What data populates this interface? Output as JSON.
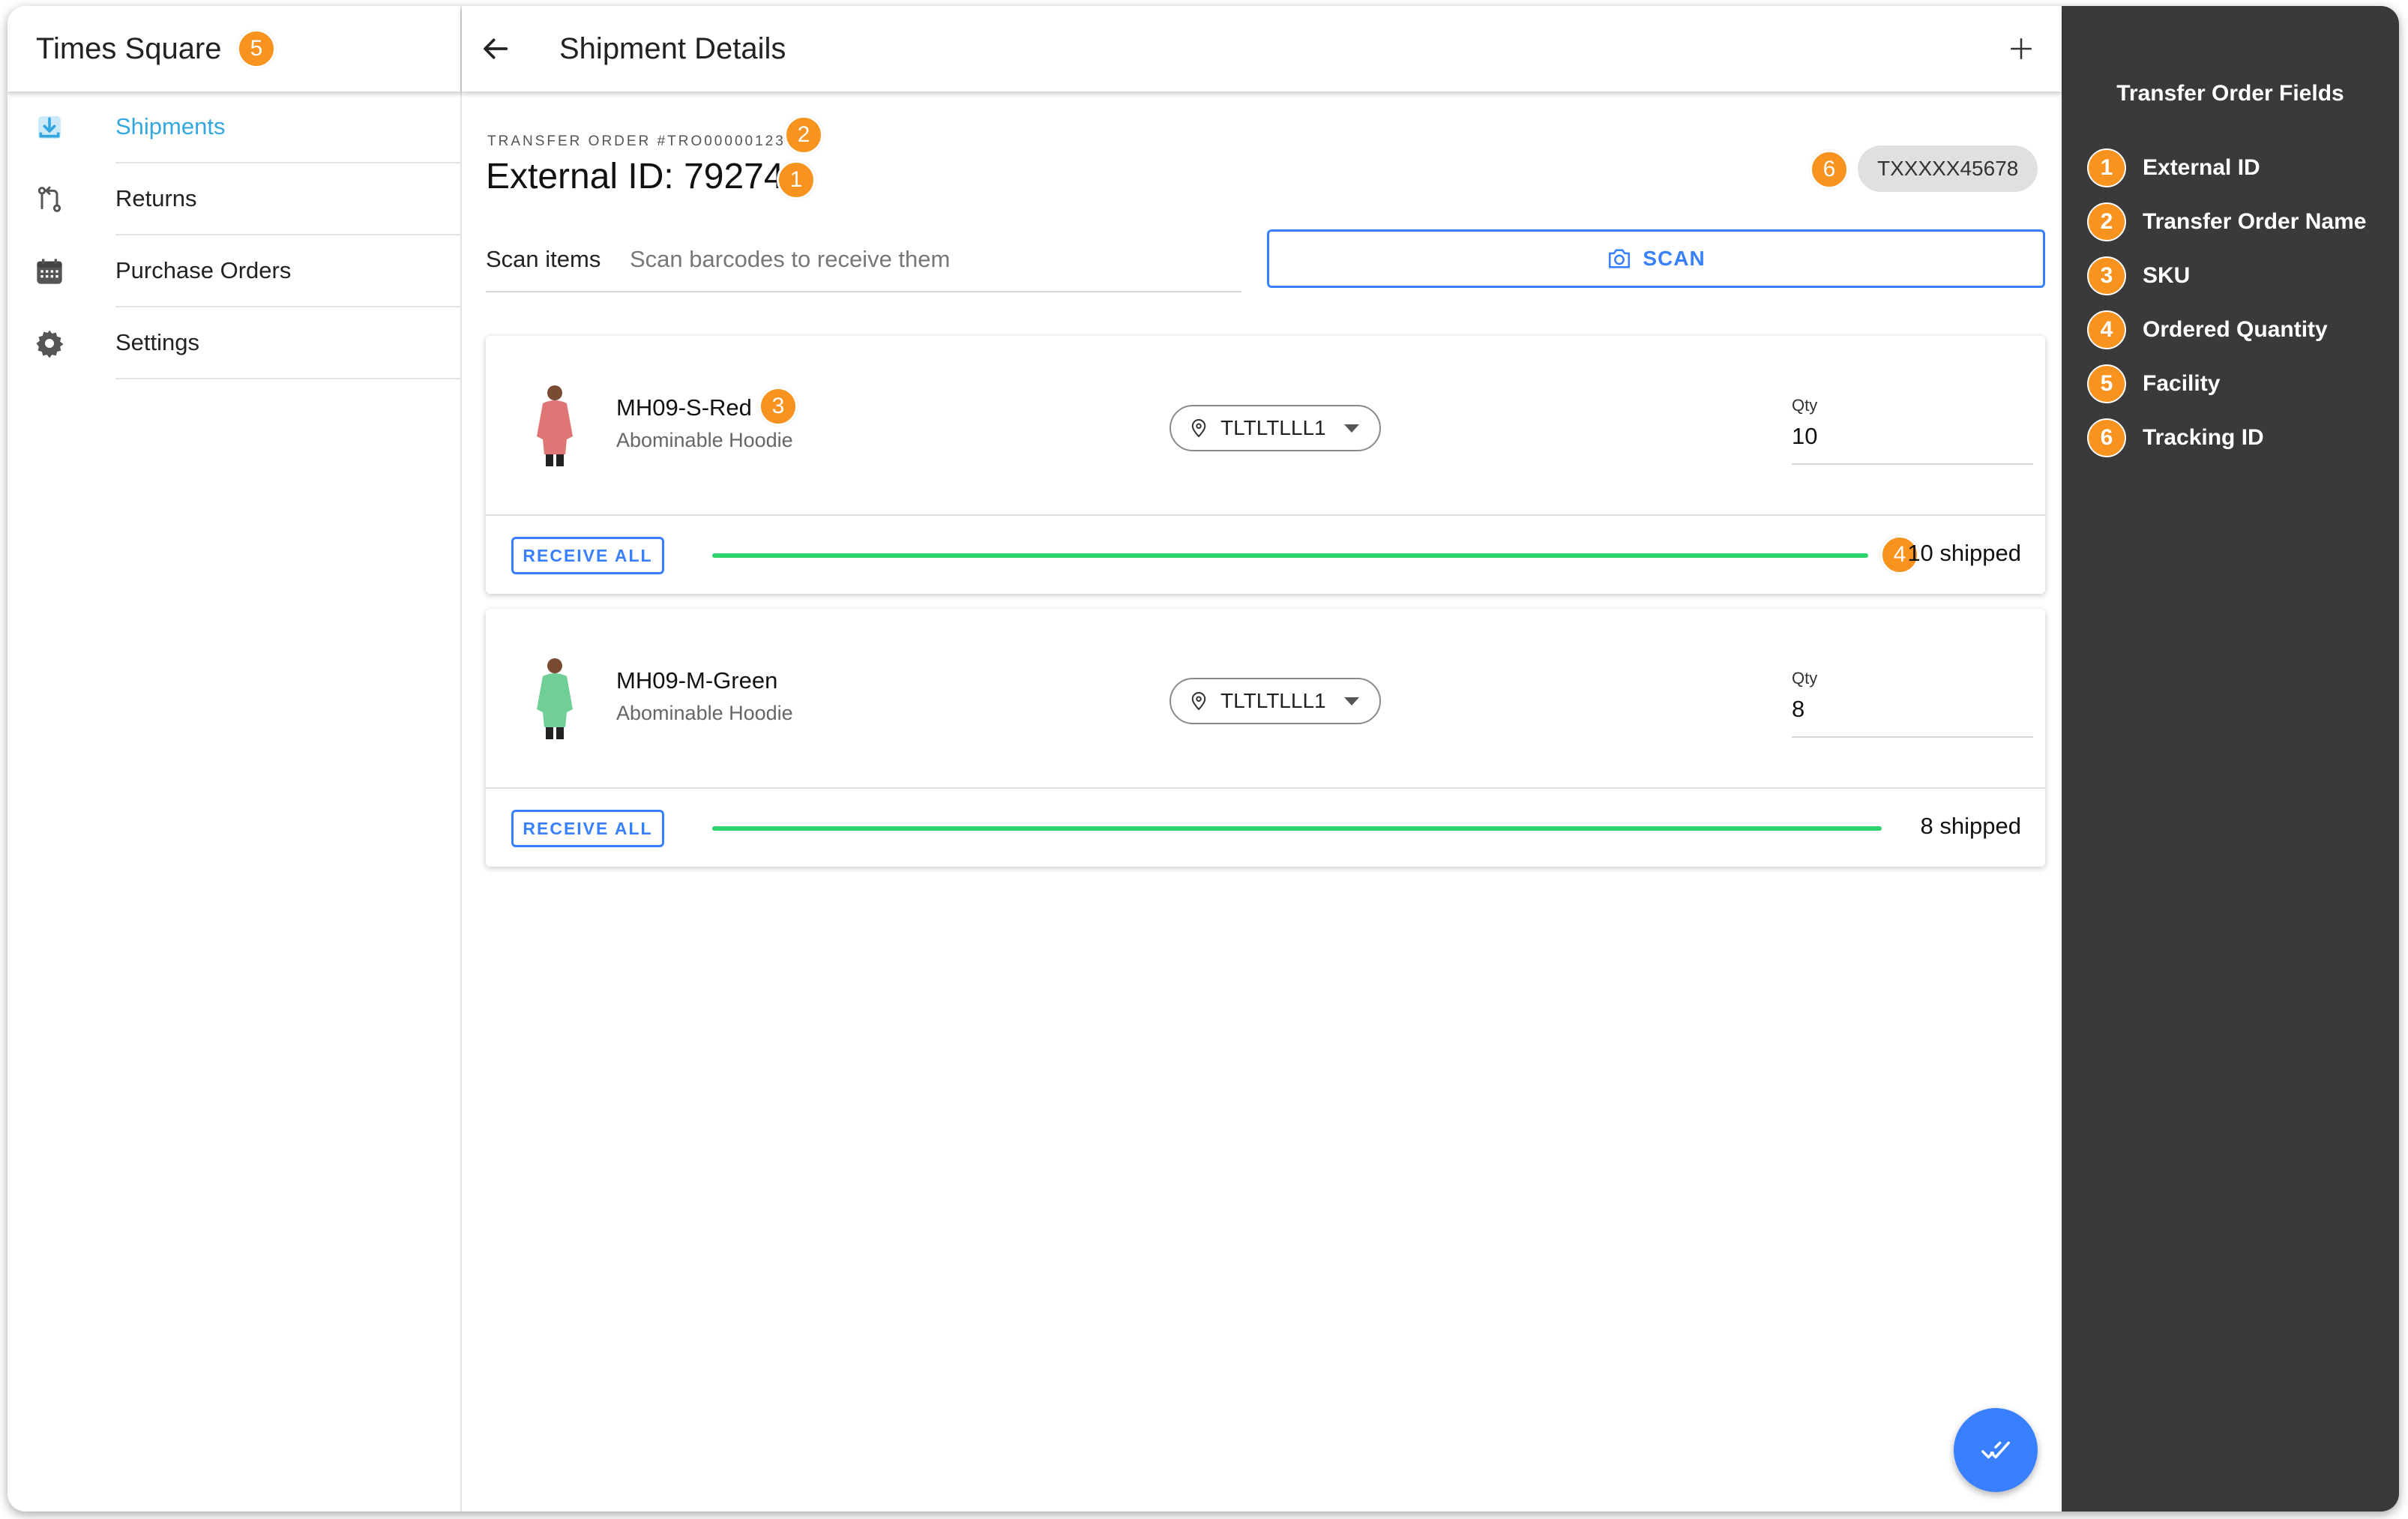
{
  "sidebar": {
    "facility": "Times Square",
    "items": [
      {
        "label": "Shipments",
        "icon": "download-icon",
        "active": true
      },
      {
        "label": "Returns",
        "icon": "git-compare-icon",
        "active": false
      },
      {
        "label": "Purchase Orders",
        "icon": "calendar-icon",
        "active": false
      },
      {
        "label": "Settings",
        "icon": "settings-icon",
        "active": false
      }
    ]
  },
  "toolbar": {
    "title": "Shipment Details",
    "back_icon": "arrow-back-icon",
    "add_icon": "add-icon"
  },
  "shipment": {
    "transfer_order_label": "TRANSFER ORDER #TRO00000123",
    "external_id": "External ID: 79274",
    "tracking_id": "TXXXXX45678"
  },
  "scan": {
    "label": "Scan items",
    "placeholder": "Scan barcodes to receive them",
    "button_label": "SCAN",
    "button_icon": "camera-icon"
  },
  "items": [
    {
      "sku": "MH09-S-Red",
      "name": "Abominable Hoodie",
      "location": "TLTLTLLL1",
      "qty_label": "Qty",
      "qty": "10",
      "receive_label": "RECEIVE ALL",
      "shipped_text": "10 shipped",
      "progress": 1.0,
      "hoodie_color": "#e07575"
    },
    {
      "sku": "MH09-M-Green",
      "name": "Abominable Hoodie",
      "location": "TLTLTLLL1",
      "qty_label": "Qty",
      "qty": "8",
      "receive_label": "RECEIVE ALL",
      "shipped_text": "8 shipped",
      "progress": 1.0,
      "hoodie_color": "#6fcf97"
    }
  ],
  "fab": {
    "icon": "checkmark-done-icon"
  },
  "legend": {
    "title": "Transfer Order Fields",
    "items": [
      {
        "num": "1",
        "label": "External ID"
      },
      {
        "num": "2",
        "label": "Transfer Order Name"
      },
      {
        "num": "3",
        "label": "SKU"
      },
      {
        "num": "4",
        "label": "Ordered Quantity"
      },
      {
        "num": "5",
        "label": "Facility"
      },
      {
        "num": "6",
        "label": "Tracking ID"
      }
    ]
  },
  "badges": {
    "facility": "5",
    "transfer_order": "2",
    "external_id": "1",
    "sku": "3",
    "ordered_qty": "4",
    "tracking": "6"
  },
  "colors": {
    "primary": "#3880ff",
    "active_menu": "#33a7e0",
    "success": "#2dd36f",
    "badge": "#f7931e",
    "legend_bg": "#3a3a3a"
  }
}
